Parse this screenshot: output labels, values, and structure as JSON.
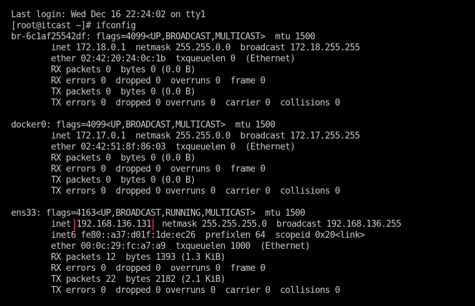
{
  "terminal": {
    "lines": [
      "Last login: Wed Dec 16 22:24:02 on tty1",
      "[root@itcast ~]# ifconfig",
      "br-6c1af25542df: flags=4099<UP,BROADCAST,MULTICAST>  mtu 1500",
      "        inet 172.18.0.1  netmask 255.255.0.0  broadcast 172.18.255.255",
      "        ether 02:42:20:24:0c:1b  txqueuelen 0  (Ethernet)",
      "        RX packets 0  bytes 0 (0.0 B)",
      "        RX errors 0  dropped 0  overruns 0  frame 0",
      "        TX packets 0  bytes 0 (0.0 B)",
      "        TX errors 0  dropped 0 overruns 0  carrier 0  collisions 0",
      "",
      "docker0: flags=4099<UP,BROADCAST,MULTICAST>  mtu 1500",
      "        inet 172.17.0.1  netmask 255.255.0.0  broadcast 172.17.255.255",
      "        ether 02:42:51:8f:86:03  txqueuelen 0  (Ethernet)",
      "        RX packets 0  bytes 0 (0.0 B)",
      "        RX errors 0  dropped 0  overruns 0  frame 0",
      "        TX packets 0  bytes 0 (0.0 B)",
      "        TX errors 0  dropped 0 overruns 0  carrier 0  collisions 0",
      "",
      "ens33: flags=4163<UP,BROADCAST,RUNNING,MULTICAST>  mtu 1500",
      "__INET_LINE__",
      "        inet6 fe80::a37:d01f:1de:ec26  prefixlen 64  scopeid 0x20<link>",
      "        ether 00:0c:29:fc:a7:a9  txqueuelen 1000  (Ethernet)",
      "        RX packets 12  bytes 1393 (1.3 KiB)",
      "        RX errors 0  dropped 0  overruns 0  frame 0",
      "        TX packets 22  bytes 2182 (2.1 KiB)",
      "        TX errors 0  dropped 0 overruns 0  carrier 0  collisions 0"
    ],
    "inet_line": {
      "prefix": "        inet ",
      "ip": "192.168.136.131",
      "suffix": "  netmask 255.255.255.0  broadcast 192.168.136.255"
    },
    "colors": {
      "background": "#000000",
      "foreground": "#c8c8c8",
      "highlight_box": "#e01818"
    }
  }
}
